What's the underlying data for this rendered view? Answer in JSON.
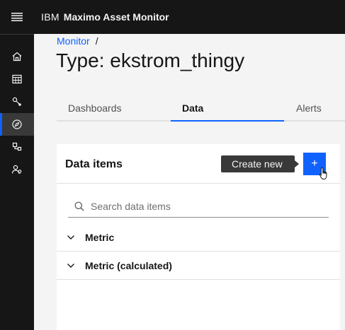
{
  "header": {
    "brand_ibm": "IBM",
    "brand_product": "Maximo Asset Monitor",
    "menu_icon": "hamburger-menu-icon"
  },
  "sidenav": {
    "items": [
      {
        "icon": "home-icon",
        "active": false
      },
      {
        "icon": "calendar-grid-icon",
        "active": false
      },
      {
        "icon": "connection-nodes-icon",
        "active": false
      },
      {
        "icon": "compass-monitor-icon",
        "active": true
      },
      {
        "icon": "asset-structure-icon",
        "active": false
      },
      {
        "icon": "user-admin-icon",
        "active": false
      }
    ]
  },
  "breadcrumb": {
    "link": "Monitor",
    "separator": "/"
  },
  "page_title": "Type: ekstrom_thingy",
  "tabs": [
    {
      "label": "Dashboards",
      "active": false
    },
    {
      "label": "Data",
      "active": true
    },
    {
      "label": "Alerts",
      "active": false
    }
  ],
  "card": {
    "title": "Data items",
    "tooltip": "Create new",
    "add_button_label": "+",
    "search": {
      "placeholder": "Search data items",
      "value": ""
    },
    "accordion": [
      {
        "label": "Metric"
      },
      {
        "label": "Metric (calculated)"
      }
    ]
  },
  "colors": {
    "header_bg": "#161616",
    "accent": "#0f62fe",
    "page_bg": "#f4f4f4",
    "card_bg": "#ffffff",
    "tooltip_bg": "#393939"
  }
}
